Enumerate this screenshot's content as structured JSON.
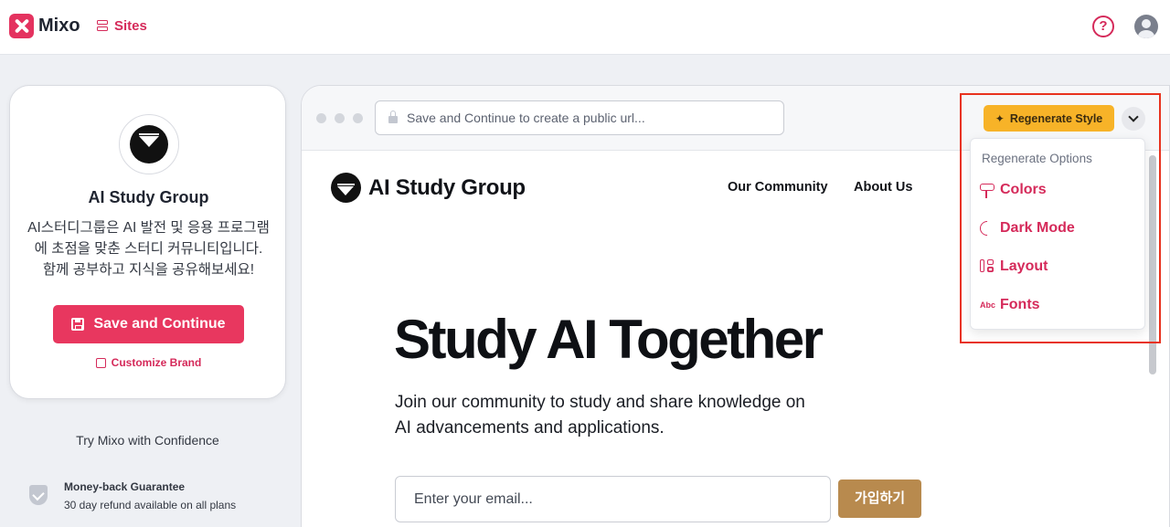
{
  "app": {
    "name": "Mixo",
    "nav_sites": "Sites",
    "help_symbol": "?"
  },
  "brand_card": {
    "name": "AI Study Group",
    "description": "AI스터디그룹은 AI 발전 및 응용 프로그램에 초점을 맞춘 스터디 커뮤니티입니다. 함께 공부하고 지식을 공유해보세요!",
    "save_label": "Save and Continue",
    "customize_label": "Customize Brand"
  },
  "confidence": {
    "title": "Try Mixo with Confidence",
    "guarantee_title": "Money-back Guarantee",
    "guarantee_sub": "30 day refund available on all plans"
  },
  "preview": {
    "url_placeholder": "Save and Continue to create a public url...",
    "site_name": "AI Study Group",
    "nav": [
      "Our Community",
      "About Us"
    ],
    "hero_title": "Study AI Together",
    "hero_subtitle": "Join our community to study and share knowledge on AI advancements and applications.",
    "email_placeholder": "Enter your email...",
    "join_label": "가입하기"
  },
  "regenerate": {
    "label": "Regenerate Style",
    "options_header": "Regenerate Options",
    "options": [
      "Colors",
      "Dark Mode",
      "Layout",
      "Fonts"
    ],
    "abc_glyph": "Abc"
  },
  "colors": {
    "accent": "#d52a5a",
    "primary_button": "#e8375f",
    "regenerate": "#f7b328",
    "join_button": "#b88a4e",
    "highlight_box": "#e8321e"
  },
  "icons": [
    "mixo-logo-icon",
    "sites-icon",
    "help-icon",
    "user-avatar-icon",
    "floppy-disk-icon",
    "customize-icon",
    "shield-check-icon",
    "lock-icon",
    "sparkle-icon",
    "chevron-down-icon",
    "paint-roller-icon",
    "moon-icon",
    "layout-icon",
    "font-abc-icon"
  ]
}
